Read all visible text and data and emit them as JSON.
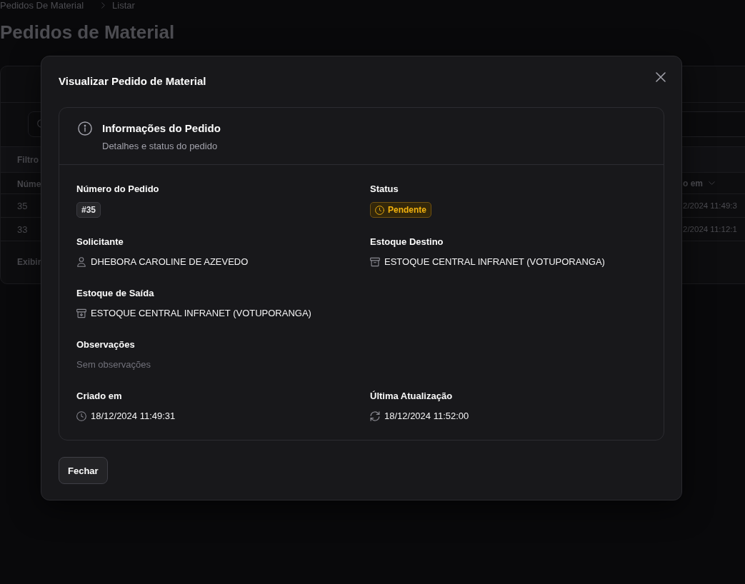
{
  "breadcrumb": [
    {
      "label": "Pedidos De Material"
    },
    {
      "label": "Listar"
    }
  ],
  "page_title": "Pedidos de Material",
  "list_card": {
    "filters_label": "Filtro",
    "columns": [
      {
        "label": "Núme"
      },
      {
        "label": "o em"
      }
    ],
    "rows": [
      {
        "cells": [
          "35",
          "2/2024 11:49:3"
        ]
      },
      {
        "cells": [
          "33",
          "2/2024 11:12:1"
        ]
      }
    ],
    "footer": "Exibir"
  },
  "dialog": {
    "title": "Visualizar Pedido de Material",
    "section": {
      "title": "Informações do Pedido",
      "subtitle": "Detalhes e status do pedido",
      "rows": [
        {
          "fields": [
            {
              "kind": "tag",
              "label": "Número do Pedido",
              "value": "#35"
            },
            {
              "kind": "status",
              "label": "Status",
              "value": "Pendente"
            }
          ]
        },
        {
          "fields": [
            {
              "kind": "person",
              "label": "Solicitante",
              "value": "DHEBORA CAROLINE DE AZEVEDO"
            },
            {
              "kind": "stock_in",
              "label": "Estoque Destino",
              "value": "ESTOQUE CENTRAL INFRANET (VOTUPORANGA)"
            }
          ]
        },
        {
          "fields": [
            {
              "kind": "stock_out",
              "label": "Estoque de Saída",
              "value": "ESTOQUE CENTRAL INFRANET (VOTUPORANGA)"
            }
          ]
        },
        {
          "fields": [
            {
              "kind": "empty",
              "label": "Observações",
              "value": "Sem observações"
            }
          ]
        },
        {
          "fields": [
            {
              "kind": "created",
              "label": "Criado em",
              "value": "18/12/2024 11:49:31"
            },
            {
              "kind": "updated",
              "label": "Última Atualização",
              "value": "18/12/2024 11:52:00"
            }
          ]
        }
      ]
    },
    "buttons": [
      {
        "label": "Fechar"
      }
    ]
  }
}
